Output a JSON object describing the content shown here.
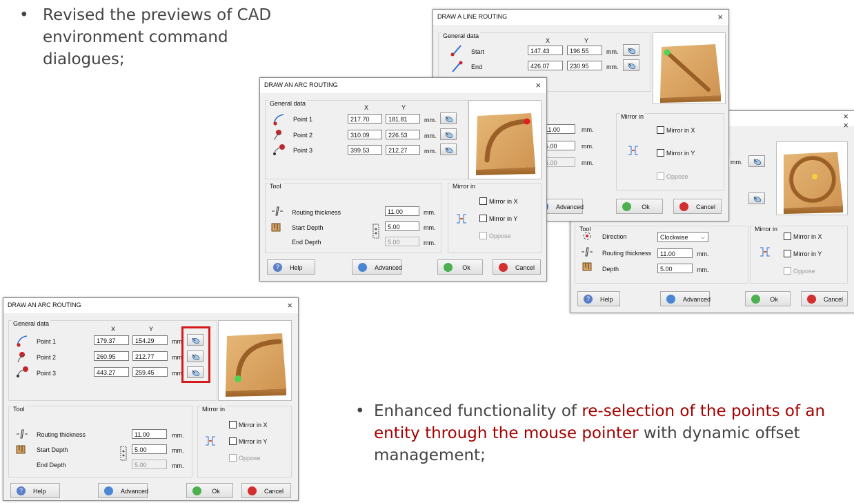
{
  "bullets": {
    "first": "Revised the previews of CAD environment command dialogues;",
    "second_pre": "Enhanced functionality of ",
    "second_hl": "re-selection of the points of an entity through the mouse pointer",
    "second_post": " with dynamic offset management;",
    "dot": "•"
  },
  "common": {
    "close": "×",
    "x_header": "X",
    "y_header": "Y",
    "unit": "mm.",
    "general_data": "General data",
    "tool": "Tool",
    "mirror_in": "Mirror in",
    "mirror_x": "Mirror in X",
    "mirror_y": "Mirror in Y",
    "oppose": "Oppose",
    "help": "Help",
    "advanced": "Advanced",
    "ok": "Ok",
    "cancel": "Cancel",
    "routing_thickness": "Routing thickness",
    "start_depth": "Start Depth",
    "end_depth": "End Depth",
    "depth": "Depth",
    "direction": "Direction",
    "point1": "Point 1",
    "point2": "Point 2",
    "point3": "Point 3",
    "start": "Start",
    "end": "End"
  },
  "line_dialog": {
    "title": "DRAW A LINE ROUTING",
    "start_x": "147.43",
    "start_y": "196.55",
    "end_x": "426.07",
    "end_y": "230.95",
    "thickness": "11.00",
    "start_depth": "5.00",
    "end_depth": "5.00"
  },
  "circle_dialog": {
    "direction": "Clockwise",
    "thickness": "11.00",
    "depth": "5.00"
  },
  "arc_dialog_top": {
    "title": "DRAW AN ARC ROUTING",
    "p1": [
      "217.70",
      "181.81"
    ],
    "p2": [
      "310.09",
      "226.53"
    ],
    "p3": [
      "399.53",
      "212.27"
    ],
    "thickness": "11.00",
    "start_depth": "5.00",
    "end_depth": "5.00"
  },
  "arc_dialog_bottom": {
    "title": "DRAW AN ARC ROUTING",
    "p1": [
      "179.37",
      "154.29"
    ],
    "p2": [
      "260.95",
      "212.77"
    ],
    "p3": [
      "443.27",
      "259.45"
    ],
    "thickness": "11.00",
    "start_depth": "5.00",
    "end_depth": "5.00"
  },
  "colors": {
    "highlight": "#a40000",
    "frame": "#d51b1b",
    "wood": "#d9a25f"
  }
}
